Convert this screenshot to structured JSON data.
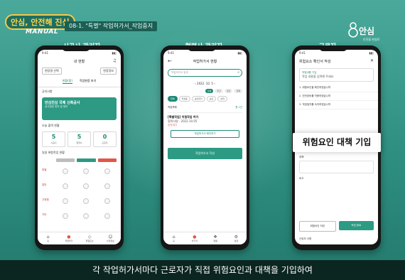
{
  "header": {
    "badge": "안심, 안전해 진심",
    "manual_label": "MANUAL",
    "topic": "08-1. \"특별\" 작업허가서_작업중지",
    "brand": "안심",
    "brand_sub": "안전을 현실로"
  },
  "roles": [
    "시공사 관리자",
    "협력사 관리자",
    "근로자"
  ],
  "phone1": {
    "status_time": "9:41",
    "title": "내 현황",
    "chips": [
      "현장명 선택",
      "현장정보"
    ],
    "tabs": [
      "현황(홈)",
      "작업현장 보기"
    ],
    "section_label": "공지사항",
    "card_title": "안심진심 국제 신축공사",
    "card_desc": "공사현장 위치 및 정보",
    "stats_label": "오늘 출역 현황",
    "stats": [
      {
        "n": "5",
        "l": "시공사"
      },
      {
        "n": "5",
        "l": "협력사"
      },
      {
        "n": "0",
        "l": "근로자"
      }
    ],
    "grid_label": "일일 위험작업 현황",
    "grid_rows": [
      "특별",
      "일반",
      "고위험",
      "기타"
    ],
    "nav": [
      "홈",
      "작업허가",
      "위험요소",
      "나의정보"
    ]
  },
  "phone2": {
    "status_time": "9:41",
    "title": "작업허가서 현황",
    "search_placeholder": "작업허가서 검색",
    "date": "2022. 10. 5",
    "segments": [
      "오늘",
      "주간",
      "월간",
      "전체"
    ],
    "pills": [
      "전체",
      "작성중",
      "승인대기",
      "승인",
      "반려",
      "작업중지"
    ],
    "list_label": "작업목록",
    "list_count": "총 1건",
    "item_title": "[특별작업] 위험작업 허가",
    "item_line": "협력사명 · 2022.10.05",
    "item_badge": "승인대기",
    "outline_button": "작업허가서 확인하기",
    "solid_button": "작업허가서 작성",
    "nav": [
      "홈",
      "허가서",
      "현황",
      "설정"
    ]
  },
  "phone3": {
    "status_time": "9:41",
    "title": "위험요소 확인서 작성",
    "box_title": "작업내용 기입",
    "box_value": "작업 내용을 입력해 주세요",
    "lines": [
      "1. 위험요인을 확인하였습니까",
      "2. 안전장비를 착용하였습니까",
      "3. 작업절차를 숙지하였습니까"
    ],
    "field1": "위험요인",
    "field2": "대책",
    "field3": "비고",
    "btn_secondary": "위험요인 저장",
    "btn_primary": "작업 완료",
    "footer": "근로자 서명"
  },
  "callout": "위험요인 대책 기입",
  "subtitle": "각 작업허가서마다 근로자가 직접 위험요인과 대책을 기입하여"
}
